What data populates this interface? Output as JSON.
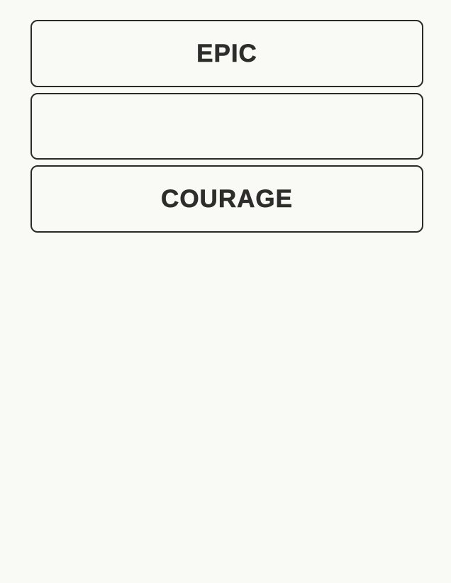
{
  "tiles": [
    {
      "label": "EPIC"
    },
    {
      "label": ""
    },
    {
      "label": "COURAGE"
    }
  ]
}
